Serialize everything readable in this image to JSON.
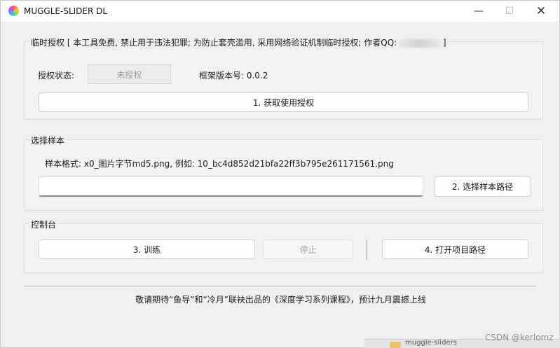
{
  "window": {
    "title": "MUGGLE-SLIDER DL",
    "minimize_glyph": "—",
    "maximize_glyph": "☐",
    "close_glyph": "✕"
  },
  "license_group": {
    "title_prefix": "临时授权 [ 本工具免费, 禁止用于违法犯罪; 为防止套壳滥用, 采用网络验证机制临时授权; 作者QQ: ",
    "title_suffix": " ]",
    "status_label": "授权状态:",
    "status_value": "未授权",
    "version_label": "框架版本号: 0.0.2",
    "get_license_button": "1. 获取使用授权"
  },
  "sample_group": {
    "title": "选择样本",
    "format_hint": "样本格式: x0_图片字节md5.png,   例如: 10_bc4d852d21bfa22ff3b795e261171561.png",
    "path_value": "",
    "choose_path_button": "2. 选择样本路径"
  },
  "console_group": {
    "title": "控制台",
    "train_button": "3. 训练",
    "stop_button": "停止",
    "open_project_button": "4. 打开项目路径"
  },
  "footer": {
    "announcement": "敬请期待“鱼导”和“冷月”联袂出品的《深度学习系列课程》，预计九月震撼上线"
  },
  "background": {
    "taskbar_label": "muggle-sliders",
    "watermark": "CSDN @kerlomz"
  }
}
